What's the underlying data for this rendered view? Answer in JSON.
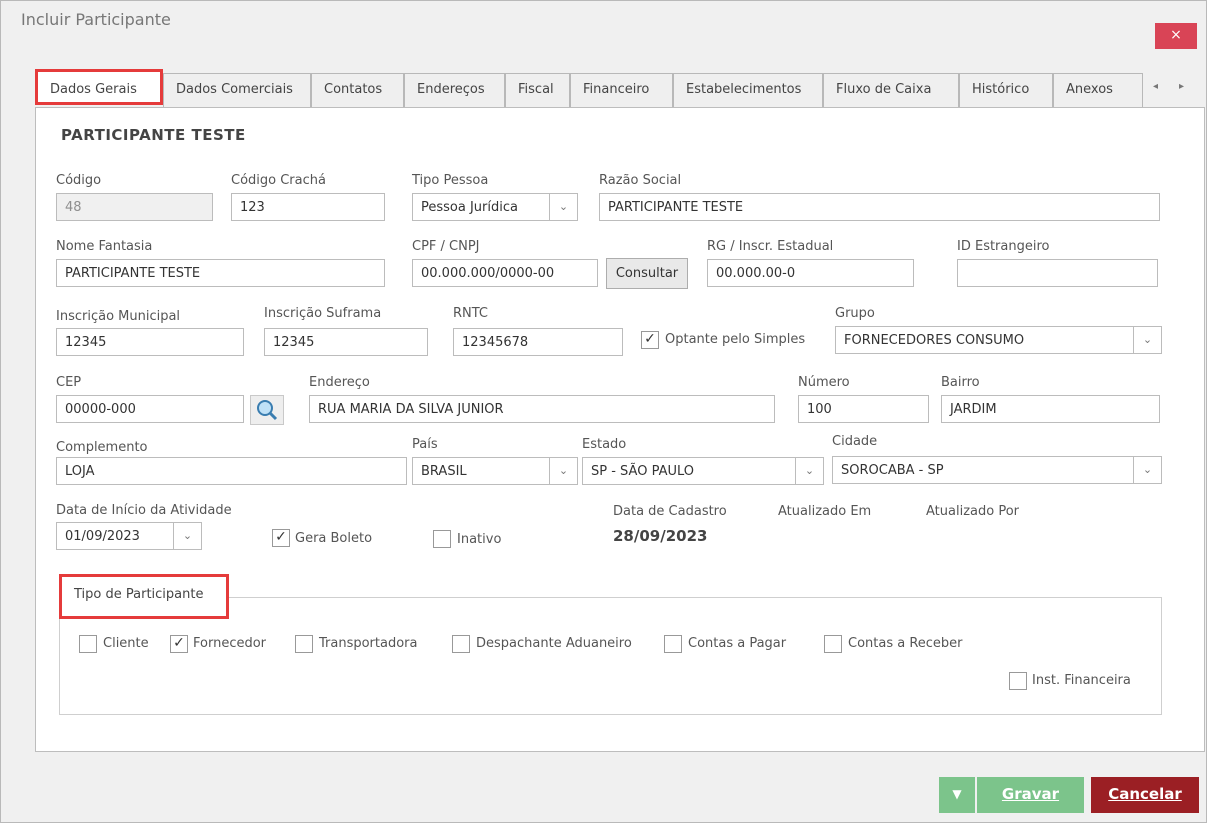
{
  "window": {
    "title": "Incluir Participante",
    "close": "×"
  },
  "tabs": [
    {
      "label": "Dados Gerais"
    },
    {
      "label": "Dados Comerciais"
    },
    {
      "label": "Contatos"
    },
    {
      "label": "Endereços"
    },
    {
      "label": "Fiscal"
    },
    {
      "label": "Financeiro"
    },
    {
      "label": "Estabelecimentos"
    },
    {
      "label": "Fluxo de Caixa"
    },
    {
      "label": "Histórico"
    },
    {
      "label": "Anexos"
    }
  ],
  "tab_scroll": {
    "left": "◂",
    "right": "▸"
  },
  "heading": "PARTICIPANTE TESTE",
  "fields": {
    "codigo": {
      "label": "Código",
      "value": "48"
    },
    "codigo_cracha": {
      "label": "Código Crachá",
      "value": "123"
    },
    "tipo_pessoa": {
      "label": "Tipo Pessoa",
      "value": "Pessoa Jurídica"
    },
    "razao_social": {
      "label": "Razão Social",
      "value": "PARTICIPANTE TESTE"
    },
    "nome_fantasia": {
      "label": "Nome Fantasia",
      "value": "PARTICIPANTE TESTE"
    },
    "cpf_cnpj": {
      "label": "CPF / CNPJ",
      "value": "00.000.000/0000-00"
    },
    "consultar": "Consultar",
    "rg_ie": {
      "label": "RG / Inscr. Estadual",
      "value": "00.000.00-0"
    },
    "id_estrangeiro": {
      "label": "ID Estrangeiro",
      "value": ""
    },
    "inscricao_municipal": {
      "label": "Inscrição Municipal",
      "value": "12345"
    },
    "inscricao_suframa": {
      "label": "Inscrição Suframa",
      "value": "12345"
    },
    "rntc": {
      "label": "RNTC",
      "value": "12345678"
    },
    "optante_simples": {
      "label": "Optante pelo Simples",
      "checked": true
    },
    "grupo": {
      "label": "Grupo",
      "value": "FORNECEDORES CONSUMO"
    },
    "cep": {
      "label": "CEP",
      "value": "00000-000"
    },
    "endereco": {
      "label": "Endereço",
      "value": "RUA MARIA DA SILVA JUNIOR"
    },
    "numero": {
      "label": "Número",
      "value": "100"
    },
    "bairro": {
      "label": "Bairro",
      "value": "JARDIM"
    },
    "complemento": {
      "label": "Complemento",
      "value": "LOJA"
    },
    "pais": {
      "label": "País",
      "value": "BRASIL"
    },
    "estado": {
      "label": "Estado",
      "value": "SP - SÃO PAULO"
    },
    "cidade": {
      "label": "Cidade",
      "value": "SOROCABA - SP"
    },
    "data_inicio": {
      "label": "Data de Início da Atividade",
      "value": "01/09/2023"
    },
    "gera_boleto": {
      "label": "Gera Boleto",
      "checked": true
    },
    "inativo": {
      "label": "Inativo",
      "checked": false
    },
    "data_cadastro": {
      "label": "Data de Cadastro",
      "value": "28/09/2023"
    },
    "atualizado_em": {
      "label": "Atualizado Em"
    },
    "atualizado_por": {
      "label": "Atualizado Por"
    }
  },
  "tipo_participante": {
    "title": "Tipo de Participante",
    "options": [
      {
        "label": "Cliente",
        "checked": false
      },
      {
        "label": "Fornecedor",
        "checked": true
      },
      {
        "label": "Transportadora",
        "checked": false
      },
      {
        "label": "Despachante Aduaneiro",
        "checked": false
      },
      {
        "label": "Contas a Pagar",
        "checked": false
      },
      {
        "label": "Contas a Receber",
        "checked": false
      },
      {
        "label": "Inst. Financeira",
        "checked": false
      }
    ]
  },
  "footer": {
    "gravar": "Gravar",
    "cancelar": "Cancelar",
    "dropdown_arrow": "▼"
  },
  "glyphs": {
    "check": "✓",
    "chevron": "⌄"
  },
  "colors": {
    "highlight": "#e53b3b",
    "gravar": "#7cc48b",
    "cancelar": "#9b1f24",
    "close": "#d94456"
  }
}
